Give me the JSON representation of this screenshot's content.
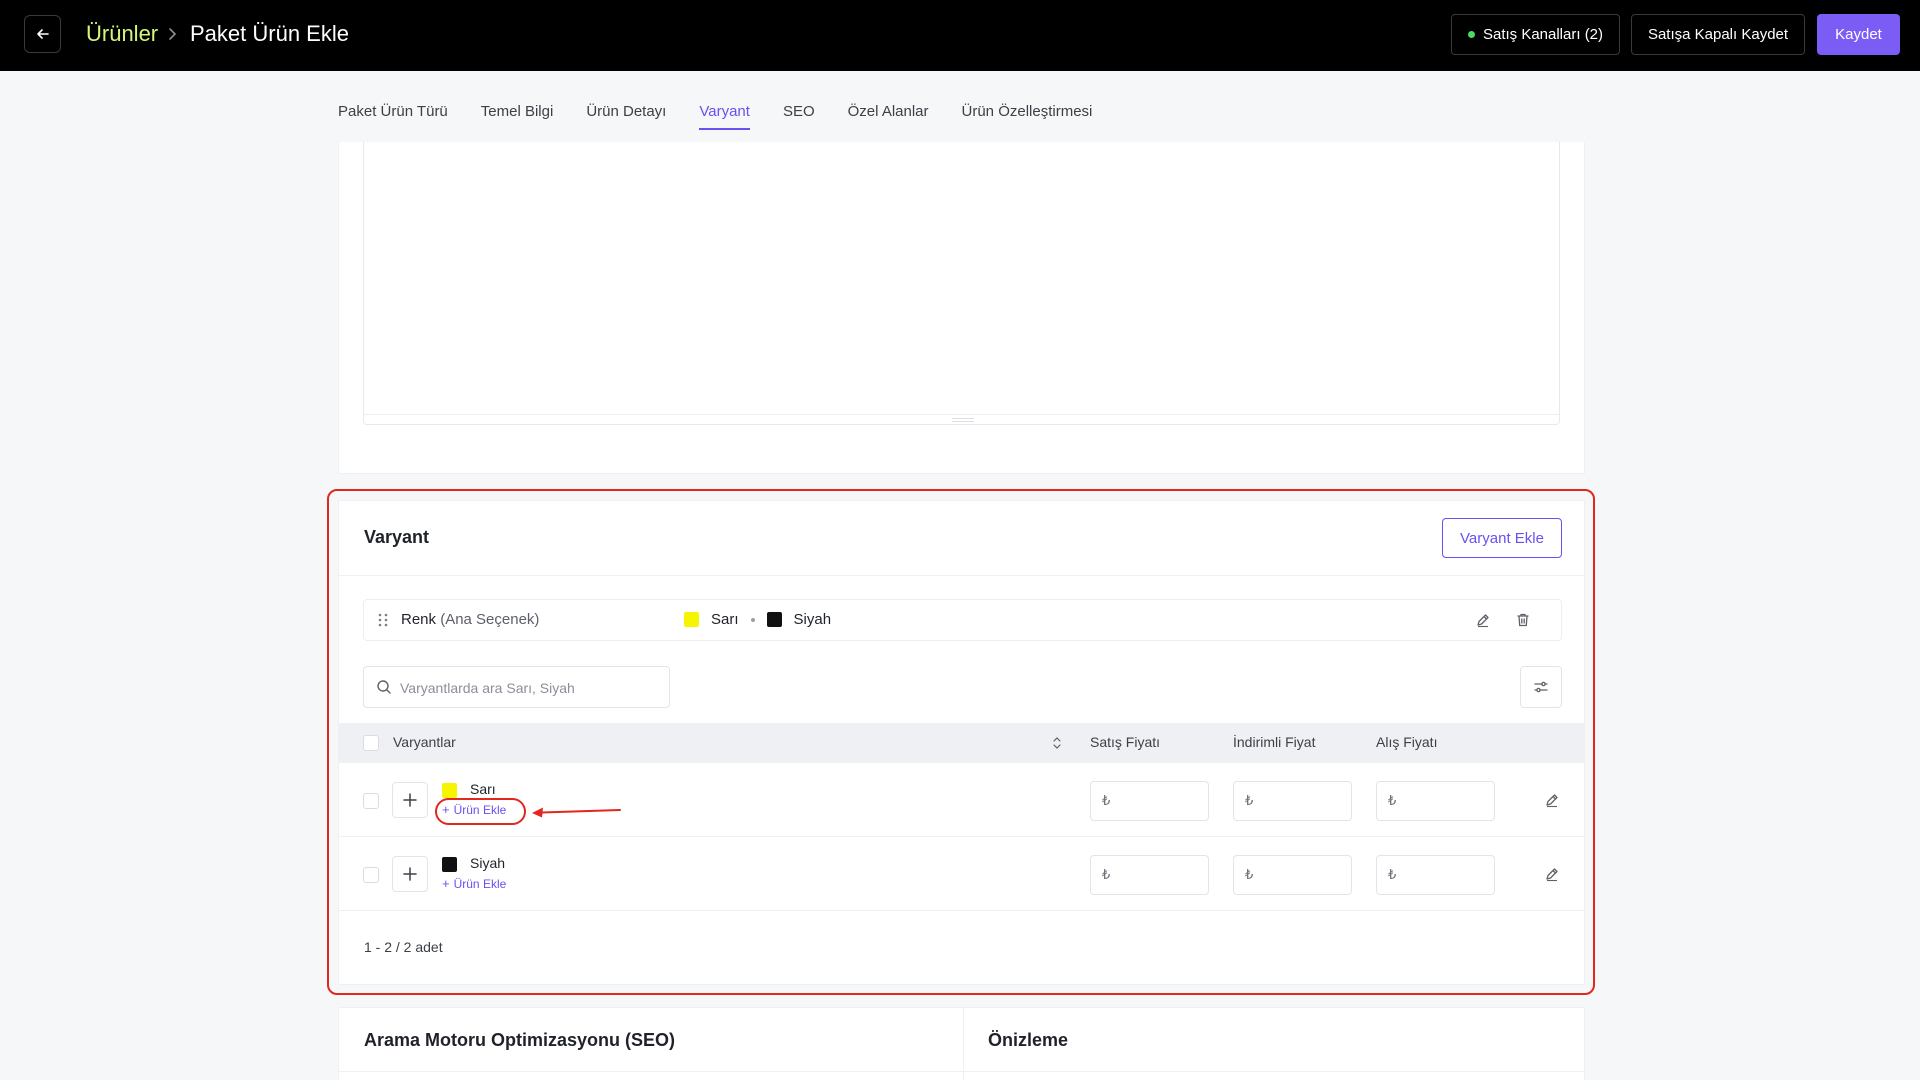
{
  "header": {
    "breadcrumb_parent": "Ürünler",
    "breadcrumb_current": "Paket Ürün Ekle",
    "sales_channels_label": "Satış Kanalları (2)",
    "save_closed_label": "Satışa Kapalı Kaydet",
    "save_label": "Kaydet"
  },
  "tabs": [
    {
      "label": "Paket Ürün Türü"
    },
    {
      "label": "Temel Bilgi"
    },
    {
      "label": "Ürün Detayı"
    },
    {
      "label": "Varyant",
      "active": true
    },
    {
      "label": "SEO"
    },
    {
      "label": "Özel Alanlar"
    },
    {
      "label": "Ürün Özelleştirmesi"
    }
  ],
  "variant": {
    "title": "Varyant",
    "add_button": "Varyant Ekle",
    "option": {
      "name": "Renk",
      "qualifier": "(Ana Seçenek)",
      "values": [
        {
          "label": "Sarı",
          "color": "#f5f500"
        },
        {
          "label": "Siyah",
          "color": "#111111"
        }
      ]
    },
    "search_placeholder": "Varyantlarda ara Sarı, Siyah",
    "columns": {
      "variants": "Varyantlar",
      "sale_price": "Satış Fiyatı",
      "discount_price": "İndirimli Fiyat",
      "purchase_price": "Alış Fiyatı"
    },
    "rows": [
      {
        "name": "Sarı",
        "color": "#f5f500",
        "add_product": "Ürün Ekle",
        "currency": "₺"
      },
      {
        "name": "Siyah",
        "color": "#111111",
        "add_product": "Ürün Ekle",
        "currency": "₺"
      }
    ],
    "pagination": "1 - 2 / 2 adet"
  },
  "seo": {
    "title": "Arama Motoru Optimizasyonu (SEO)",
    "preview_title": "Önizleme"
  },
  "colors": {
    "accent": "#7b5cf5",
    "breadcrumb": "#d4f77a",
    "annotation": "#e3261e"
  }
}
